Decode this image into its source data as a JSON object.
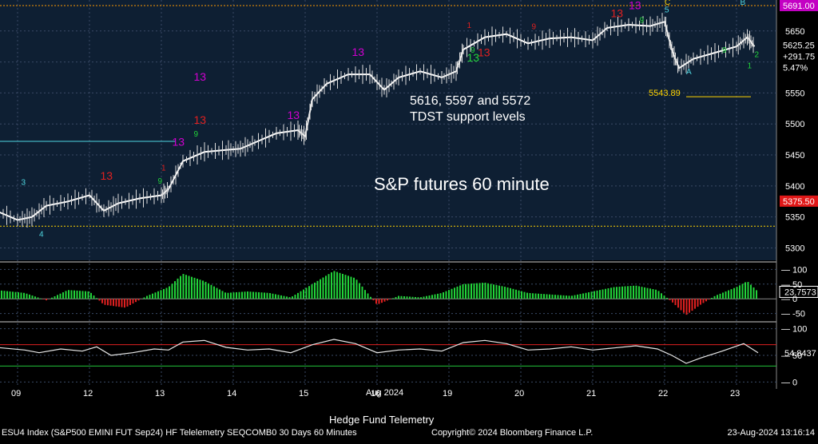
{
  "chart_data": {
    "type": "candlestick",
    "title": "S&P futures 60 minute",
    "subtitle": "Hedge Fund Telemetry",
    "annotation_support": [
      "5616, 5597 and 5572",
      "TDST support levels"
    ],
    "annotation_low": "5543.89",
    "x_tick_labels": [
      {
        "label": "09",
        "x": 0
      },
      {
        "label": "12",
        "x": 1
      },
      {
        "label": "13",
        "x": 2
      },
      {
        "label": "14",
        "x": 3
      },
      {
        "label": "15",
        "x": 4
      },
      {
        "label": "16",
        "x": 5
      },
      {
        "label": "19",
        "x": 6
      },
      {
        "label": "20",
        "x": 7
      },
      {
        "label": "21",
        "x": 8
      },
      {
        "label": "22",
        "x": 9
      },
      {
        "label": "23",
        "x": 10
      }
    ],
    "x_month_label": "Aug 2024",
    "price_axis": {
      "ylim": [
        5280,
        5700
      ],
      "ticks": [
        5300,
        5350,
        5400,
        5450,
        5500,
        5550,
        5600,
        5650
      ]
    },
    "price_series": [
      {
        "x": -0.3,
        "y": 5360
      },
      {
        "x": 0.0,
        "y": 5345
      },
      {
        "x": 0.2,
        "y": 5350
      },
      {
        "x": 0.4,
        "y": 5368
      },
      {
        "x": 0.7,
        "y": 5375
      },
      {
        "x": 1.0,
        "y": 5385
      },
      {
        "x": 1.2,
        "y": 5360
      },
      {
        "x": 1.4,
        "y": 5372
      },
      {
        "x": 1.7,
        "y": 5380
      },
      {
        "x": 2.0,
        "y": 5385
      },
      {
        "x": 2.1,
        "y": 5395
      },
      {
        "x": 2.3,
        "y": 5440
      },
      {
        "x": 2.6,
        "y": 5455
      },
      {
        "x": 2.9,
        "y": 5458
      },
      {
        "x": 3.1,
        "y": 5460
      },
      {
        "x": 3.3,
        "y": 5470
      },
      {
        "x": 3.6,
        "y": 5485
      },
      {
        "x": 3.9,
        "y": 5490
      },
      {
        "x": 4.0,
        "y": 5480
      },
      {
        "x": 4.1,
        "y": 5540
      },
      {
        "x": 4.3,
        "y": 5565
      },
      {
        "x": 4.6,
        "y": 5580
      },
      {
        "x": 4.9,
        "y": 5580
      },
      {
        "x": 5.1,
        "y": 5555
      },
      {
        "x": 5.3,
        "y": 5575
      },
      {
        "x": 5.6,
        "y": 5585
      },
      {
        "x": 5.9,
        "y": 5575
      },
      {
        "x": 6.1,
        "y": 5585
      },
      {
        "x": 6.2,
        "y": 5620
      },
      {
        "x": 6.5,
        "y": 5640
      },
      {
        "x": 6.8,
        "y": 5645
      },
      {
        "x": 7.1,
        "y": 5630
      },
      {
        "x": 7.4,
        "y": 5638
      },
      {
        "x": 7.7,
        "y": 5640
      },
      {
        "x": 8.0,
        "y": 5635
      },
      {
        "x": 8.2,
        "y": 5655
      },
      {
        "x": 8.5,
        "y": 5660
      },
      {
        "x": 8.8,
        "y": 5658
      },
      {
        "x": 9.0,
        "y": 5665
      },
      {
        "x": 9.1,
        "y": 5620
      },
      {
        "x": 9.2,
        "y": 5590
      },
      {
        "x": 9.4,
        "y": 5605
      },
      {
        "x": 9.7,
        "y": 5615
      },
      {
        "x": 10.0,
        "y": 5625
      },
      {
        "x": 10.15,
        "y": 5640
      },
      {
        "x": 10.25,
        "y": 5625
      }
    ],
    "horizontal_levels": [
      {
        "name": "5691.00",
        "y": 5691,
        "color": "#ff9900",
        "style": "dotted"
      },
      {
        "name": "5375.50",
        "y": 5375.5,
        "color": "#ff3333",
        "style": "none"
      },
      {
        "name": "5335",
        "y": 5335,
        "color": "#ffd400",
        "style": "dotted"
      },
      {
        "name": "cyan-5472",
        "y": 5472,
        "color": "#4fd6e0",
        "style": "solid"
      },
      {
        "name": "5543.89",
        "y": 5543.89,
        "color": "#ffd400",
        "style": "solid"
      }
    ],
    "price_labels": [
      {
        "text": "5691.00",
        "y": 5691,
        "bg": "#c300c3",
        "fg": "#ffffff"
      },
      {
        "text": "5625.25",
        "y": 5627,
        "bg": "#000000",
        "fg": "#ffffff"
      },
      {
        "text": "+291.75",
        "y": 5609,
        "bg": "#000000",
        "fg": "#ffffff"
      },
      {
        "text": "5.47%",
        "y": 5591,
        "bg": "#000000",
        "fg": "#ffffff"
      },
      {
        "text": "5375.50",
        "y": 5375.5,
        "bg": "#e01818",
        "fg": "#ffffff"
      }
    ],
    "td_annotations": [
      {
        "text": "13",
        "x": 2.45,
        "y": 5570,
        "color": "#d000d0"
      },
      {
        "text": "13",
        "x": 4.65,
        "y": 5610,
        "color": "#d000d0"
      },
      {
        "text": "13",
        "x": 3.75,
        "y": 5508,
        "color": "#d000d0"
      },
      {
        "text": "13",
        "x": 2.15,
        "y": 5465,
        "color": "#d000d0"
      },
      {
        "text": "13",
        "x": 8.5,
        "y": 5685,
        "color": "#d000d0"
      },
      {
        "text": "13",
        "x": 8.25,
        "y": 5672,
        "color": "#e02020"
      },
      {
        "text": "13",
        "x": 2.45,
        "y": 5500,
        "color": "#e02020"
      },
      {
        "text": "13",
        "x": 1.15,
        "y": 5410,
        "color": "#e02020"
      },
      {
        "text": "13",
        "x": 6.4,
        "y": 5609,
        "color": "#e02020"
      },
      {
        "text": "13",
        "x": 6.25,
        "y": 5601,
        "color": "#22d33a"
      },
      {
        "text": "9",
        "x": 2.45,
        "y": 5480,
        "color": "#22d33a"
      },
      {
        "text": "9",
        "x": 8.65,
        "y": 5663,
        "color": "#22d33a"
      },
      {
        "text": "9",
        "x": 9.8,
        "y": 5615,
        "color": "#22d33a"
      },
      {
        "text": "9",
        "x": 1.95,
        "y": 5404,
        "color": "#22d33a"
      },
      {
        "text": "9",
        "x": 6.3,
        "y": 5615,
        "color": "#22d33a"
      },
      {
        "text": "9",
        "x": 7.15,
        "y": 5653,
        "color": "#e02020"
      },
      {
        "text": "5",
        "x": 9.0,
        "y": 5680,
        "color": "#4fd6e0"
      },
      {
        "text": "C",
        "x": 9.0,
        "y": 5692,
        "color": "#ffd400"
      },
      {
        "text": "B",
        "x": 10.05,
        "y": 5692,
        "color": "#4fd6e0"
      },
      {
        "text": "A",
        "x": 9.3,
        "y": 5580,
        "color": "#4fd6e0"
      },
      {
        "text": "3",
        "x": 0.05,
        "y": 5402,
        "color": "#4fd6e0"
      },
      {
        "text": "4",
        "x": 0.3,
        "y": 5318,
        "color": "#4fd6e0"
      },
      {
        "text": "1",
        "x": 10.15,
        "y": 5590,
        "color": "#22d33a"
      },
      {
        "text": "2",
        "x": 10.25,
        "y": 5608,
        "color": "#22d33a"
      },
      {
        "text": "1",
        "x": 6.25,
        "y": 5655,
        "color": "#e02020"
      },
      {
        "text": "1",
        "x": 2.0,
        "y": 5425,
        "color": "#e02020"
      }
    ],
    "momentum_axis": {
      "ylim": [
        -70,
        120
      ],
      "ticks": [
        100,
        50,
        0,
        -50
      ]
    },
    "momentum_value": "23.7573",
    "momentum_series": [
      {
        "x": -0.3,
        "y": 30
      },
      {
        "x": 0.1,
        "y": 20
      },
      {
        "x": 0.4,
        "y": -5
      },
      {
        "x": 0.7,
        "y": 30
      },
      {
        "x": 1.0,
        "y": 25
      },
      {
        "x": 1.2,
        "y": -20
      },
      {
        "x": 1.5,
        "y": -30
      },
      {
        "x": 1.8,
        "y": 10
      },
      {
        "x": 2.1,
        "y": 40
      },
      {
        "x": 2.3,
        "y": 85
      },
      {
        "x": 2.6,
        "y": 60
      },
      {
        "x": 2.9,
        "y": 20
      },
      {
        "x": 3.2,
        "y": 25
      },
      {
        "x": 3.5,
        "y": 20
      },
      {
        "x": 3.8,
        "y": 5
      },
      {
        "x": 4.1,
        "y": 50
      },
      {
        "x": 4.4,
        "y": 95
      },
      {
        "x": 4.7,
        "y": 70
      },
      {
        "x": 5.0,
        "y": -20
      },
      {
        "x": 5.3,
        "y": 10
      },
      {
        "x": 5.6,
        "y": 5
      },
      {
        "x": 5.9,
        "y": 20
      },
      {
        "x": 6.2,
        "y": 50
      },
      {
        "x": 6.5,
        "y": 55
      },
      {
        "x": 6.8,
        "y": 40
      },
      {
        "x": 7.1,
        "y": 20
      },
      {
        "x": 7.4,
        "y": 15
      },
      {
        "x": 7.7,
        "y": 10
      },
      {
        "x": 8.0,
        "y": 25
      },
      {
        "x": 8.3,
        "y": 40
      },
      {
        "x": 8.6,
        "y": 45
      },
      {
        "x": 8.9,
        "y": 30
      },
      {
        "x": 9.1,
        "y": -10
      },
      {
        "x": 9.3,
        "y": -55
      },
      {
        "x": 9.5,
        "y": -20
      },
      {
        "x": 9.7,
        "y": 10
      },
      {
        "x": 10.0,
        "y": 40
      },
      {
        "x": 10.15,
        "y": 60
      },
      {
        "x": 10.3,
        "y": 24
      }
    ],
    "oscillator_axis": {
      "ylim": [
        -10,
        110
      ],
      "ticks": [
        100,
        50,
        0
      ]
    },
    "oscillator_value": "54.8437",
    "oscillator_series": [
      {
        "x": -0.3,
        "y": 65
      },
      {
        "x": 0.1,
        "y": 60
      },
      {
        "x": 0.3,
        "y": 55
      },
      {
        "x": 0.6,
        "y": 62
      },
      {
        "x": 0.9,
        "y": 58
      },
      {
        "x": 1.1,
        "y": 66
      },
      {
        "x": 1.3,
        "y": 50
      },
      {
        "x": 1.6,
        "y": 55
      },
      {
        "x": 1.9,
        "y": 62
      },
      {
        "x": 2.1,
        "y": 60
      },
      {
        "x": 2.3,
        "y": 75
      },
      {
        "x": 2.6,
        "y": 78
      },
      {
        "x": 2.9,
        "y": 65
      },
      {
        "x": 3.2,
        "y": 60
      },
      {
        "x": 3.5,
        "y": 62
      },
      {
        "x": 3.8,
        "y": 55
      },
      {
        "x": 4.1,
        "y": 70
      },
      {
        "x": 4.4,
        "y": 80
      },
      {
        "x": 4.7,
        "y": 72
      },
      {
        "x": 5.0,
        "y": 55
      },
      {
        "x": 5.3,
        "y": 60
      },
      {
        "x": 5.6,
        "y": 62
      },
      {
        "x": 5.9,
        "y": 58
      },
      {
        "x": 6.2,
        "y": 74
      },
      {
        "x": 6.5,
        "y": 78
      },
      {
        "x": 6.8,
        "y": 72
      },
      {
        "x": 7.1,
        "y": 60
      },
      {
        "x": 7.4,
        "y": 62
      },
      {
        "x": 7.7,
        "y": 66
      },
      {
        "x": 8.0,
        "y": 60
      },
      {
        "x": 8.3,
        "y": 64
      },
      {
        "x": 8.6,
        "y": 68
      },
      {
        "x": 8.9,
        "y": 62
      },
      {
        "x": 9.1,
        "y": 50
      },
      {
        "x": 9.3,
        "y": 35
      },
      {
        "x": 9.5,
        "y": 45
      },
      {
        "x": 9.8,
        "y": 58
      },
      {
        "x": 10.1,
        "y": 72
      },
      {
        "x": 10.3,
        "y": 55
      }
    ],
    "oscillator_levels": [
      {
        "y": 70,
        "color": "#e02020"
      },
      {
        "y": 30,
        "color": "#22c33a"
      }
    ]
  },
  "footer": {
    "left": "ESU4 Index (S&P500 EMINI FUT  Sep24) HF Telelemetry SEQCOMB0 30 Days 60 Minutes",
    "center": "Copyright© 2024 Bloomberg Finance L.P.",
    "right": "23-Aug-2024 13:16:14"
  },
  "colors": {
    "price_bg": "#0e1f33",
    "panel_bg": "#000000",
    "grid": "#3a4a66",
    "price": "#ffffff"
  }
}
